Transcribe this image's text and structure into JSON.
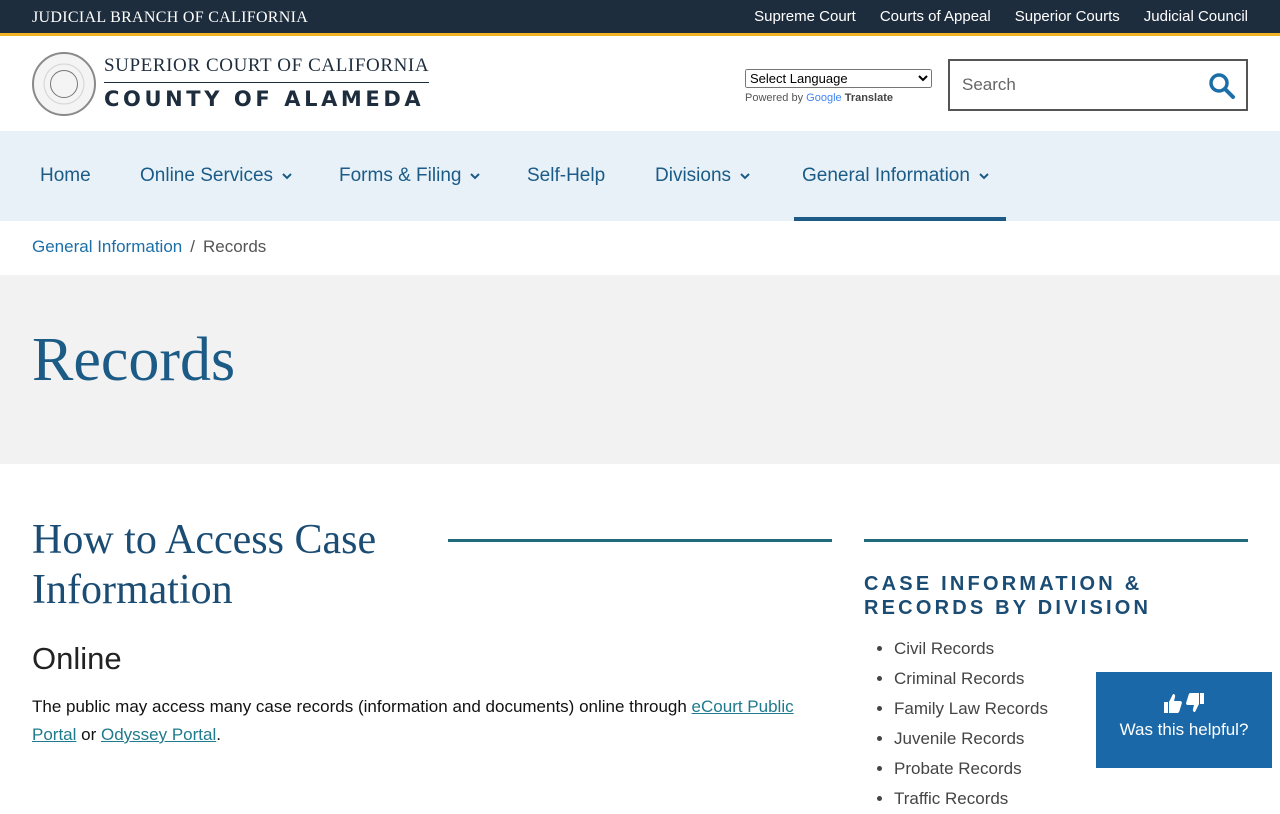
{
  "topbar": {
    "brand": "JUDICIAL BRANCH OF CALIFORNIA",
    "links": [
      "Supreme Court",
      "Courts of Appeal",
      "Superior Courts",
      "Judicial Council"
    ]
  },
  "header": {
    "line1": "SUPERIOR COURT OF CALIFORNIA",
    "line2": "COUNTY OF ALAMEDA",
    "seal_text": "JUDICIAL BRANCH OF CALIFORNIA"
  },
  "translate": {
    "select_label": "Select Language",
    "powered_by": "Powered by",
    "google": "Google",
    "translate_word": "Translate"
  },
  "search": {
    "placeholder": "Search"
  },
  "nav": {
    "items": [
      {
        "label": "Home"
      },
      {
        "label": "Online Services"
      },
      {
        "label": "Forms & Filing"
      },
      {
        "label": "Self-Help"
      },
      {
        "label": "Divisions"
      },
      {
        "label": "General Information"
      }
    ]
  },
  "breadcrumb": {
    "parent": "General Information",
    "separator": "/",
    "current": "Records"
  },
  "hero": {
    "title": "Records"
  },
  "main": {
    "heading": "How to Access Case Information",
    "subheading": "Online",
    "para_prefix": "The public may access many case records (information and documents) online through ",
    "link1": "eCourt Public Portal",
    "para_mid": " or ",
    "link2": "Odyssey Portal",
    "para_end": "."
  },
  "sidebar": {
    "heading": "CASE INFORMATION & RECORDS BY DIVISION",
    "items": [
      "Civil Records",
      "Criminal Records",
      "Family Law Records",
      "Juvenile Records",
      "Probate Records",
      "Traffic Records"
    ]
  },
  "feedback": {
    "label": "Was this helpful?"
  },
  "colors": {
    "brand_dark": "#1e2d3d",
    "accent_gold": "#f0b323",
    "link_blue": "#1b5b86",
    "nav_bg": "#e8f1f8",
    "feedback_bg": "#1a68a8"
  }
}
